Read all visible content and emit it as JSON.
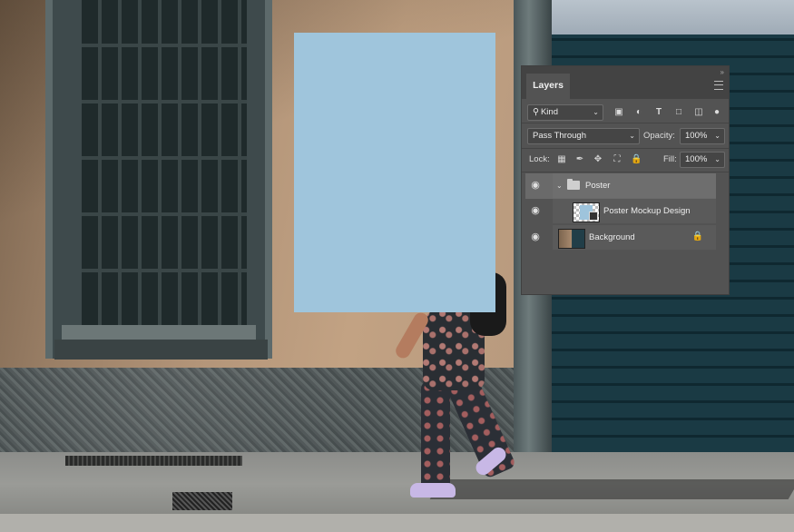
{
  "colors": {
    "poster_fill": "#9fc5dc",
    "panel_bg": "#535353"
  },
  "layers_panel": {
    "tab_label": "Layers",
    "menu_icon": "hamburger-icon",
    "filter": {
      "kind_label": "Kind",
      "filter_icons": [
        "pixel-image-icon",
        "adjustment-icon",
        "type-icon",
        "shape-icon",
        "smart-object-icon",
        "toggle-icon"
      ]
    },
    "blend_mode": "Pass Through",
    "opacity_label": "Opacity:",
    "opacity_value": "100%",
    "lock_label": "Lock:",
    "lock_icons": [
      "lock-transparent-icon",
      "lock-pixels-icon",
      "lock-position-icon",
      "lock-artboard-icon",
      "lock-all-icon"
    ],
    "fill_label": "Fill:",
    "fill_value": "100%",
    "layers": [
      {
        "name": "Poster",
        "type": "group",
        "selected": true,
        "visible": true
      },
      {
        "name": "Poster Mockup Design",
        "type": "smart-object",
        "selected": false,
        "visible": true
      },
      {
        "name": "Background",
        "type": "image",
        "selected": false,
        "visible": true,
        "locked": true
      }
    ]
  }
}
